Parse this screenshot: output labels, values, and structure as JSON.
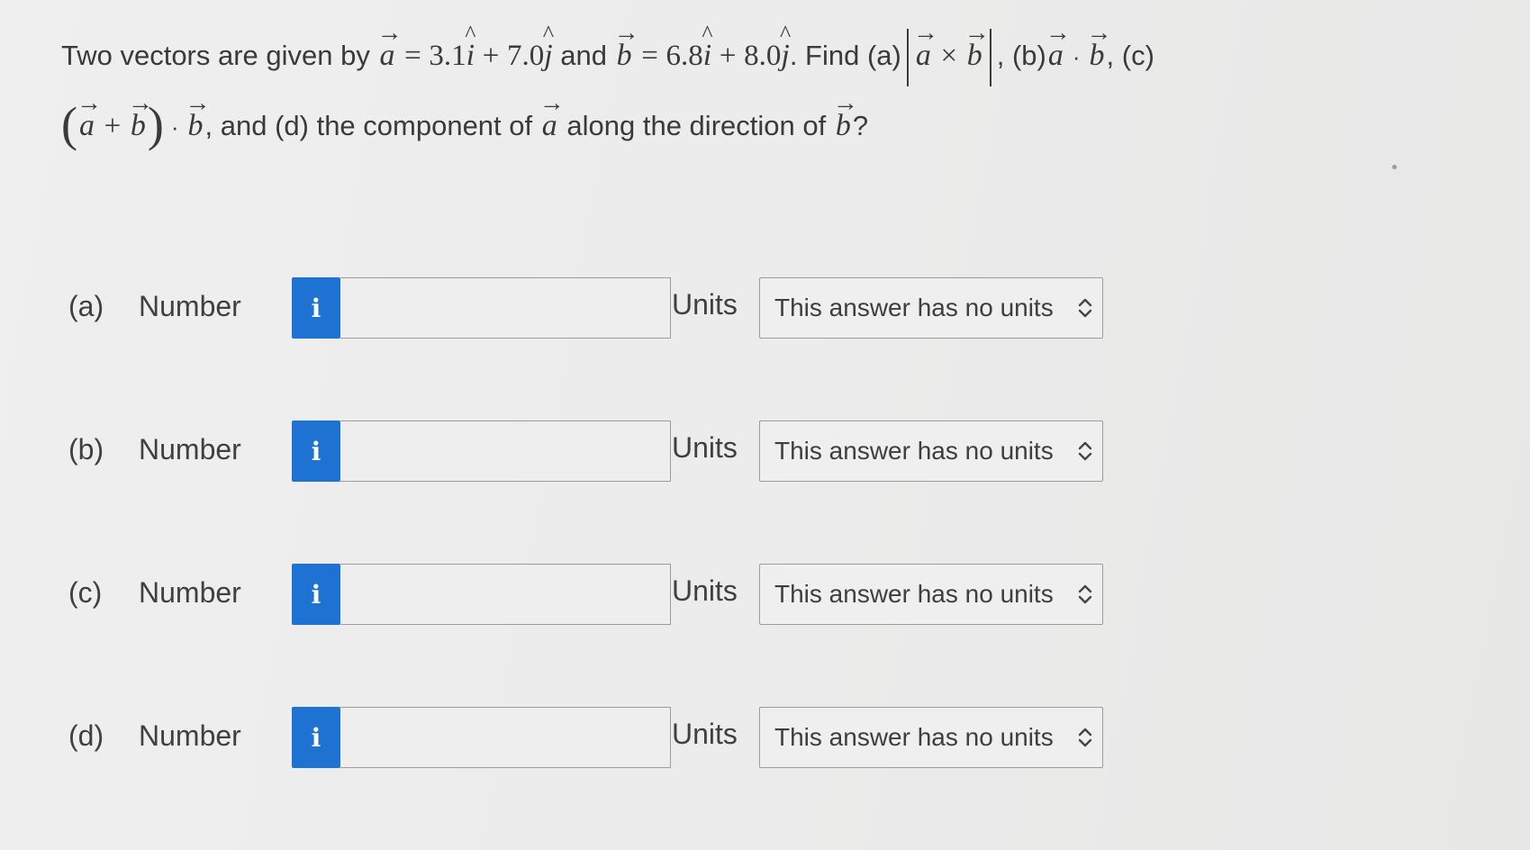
{
  "question": {
    "text_two_vectors": "Two vectors are given by",
    "vec_a_symbol": "a",
    "vec_b_symbol": "b",
    "equals": "=",
    "a_x_coef": "3.1",
    "a_y_coef": "7.0",
    "plus": "+",
    "unit_i": "i",
    "unit_j": "j",
    "text_and": "and",
    "b_x_coef": "6.8",
    "b_y_coef": "8.0",
    "text_find_a": ". Find (a)",
    "cross": "×",
    "text_b_part": ", (b)",
    "text_c_part": ", (c)",
    "dot_symbol": "·",
    "text_and_d": ", and (d) the component of",
    "text_along": "along the direction of",
    "question_mark": "?"
  },
  "rows": [
    {
      "part": "(a)",
      "number_label": "Number",
      "info_icon": "i",
      "input_value": "",
      "units_label": "Units",
      "units_value": "This answer has no units"
    },
    {
      "part": "(b)",
      "number_label": "Number",
      "info_icon": "i",
      "input_value": "",
      "units_label": "Units",
      "units_value": "This answer has no units"
    },
    {
      "part": "(c)",
      "number_label": "Number",
      "info_icon": "i",
      "input_value": "",
      "units_label": "Units",
      "units_value": "This answer has no units"
    },
    {
      "part": "(d)",
      "number_label": "Number",
      "info_icon": "i",
      "input_value": "",
      "units_label": "Units",
      "units_value": "This answer has no units"
    }
  ],
  "icons": {
    "info": "info-icon",
    "select_arrows": "chevron-up-down-icon",
    "vector_arrow": "→",
    "unit_hat": "^"
  },
  "colors": {
    "info_button": "#1e73d2",
    "background": "#ececec",
    "text": "#3f3f3f",
    "border": "#9c9c9c"
  }
}
